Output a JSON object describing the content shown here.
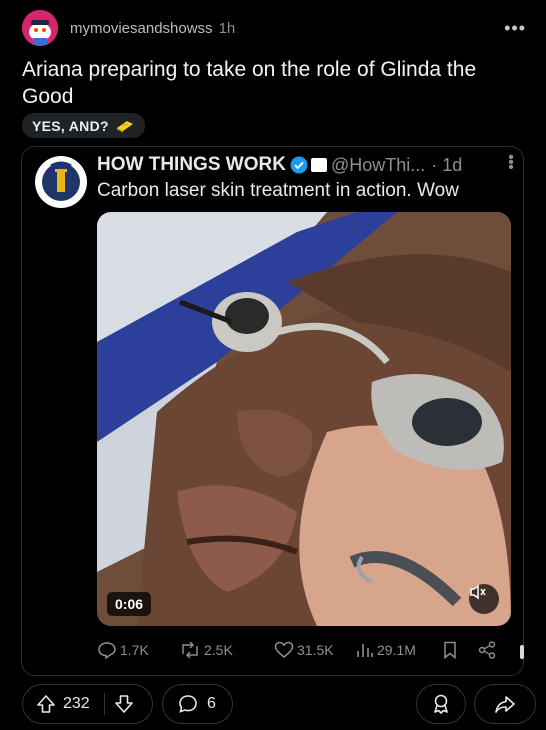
{
  "post": {
    "username": "mymoviesandshowss",
    "time": "1h",
    "title": "Ariana preparing to take on the role of Glinda the Good",
    "flair": "YES, AND?",
    "flair_emoji": "sponge-emoji"
  },
  "tweet": {
    "name": "HOW THINGS WORK",
    "handle": "@HowThi...",
    "time": "· 1d",
    "text": "Carbon laser skin treatment in action. Wow",
    "video_duration": "0:06",
    "replies": "1.7K",
    "retweets": "2.5K",
    "likes": "31.5K",
    "views": "29.1M"
  },
  "footer": {
    "upvotes": "232",
    "comments": "6"
  },
  "colors": {
    "background": "#000000",
    "avatar_bg": "#d4256e",
    "verified_blue": "#1d9bf0",
    "pill_border": "#30343a"
  }
}
